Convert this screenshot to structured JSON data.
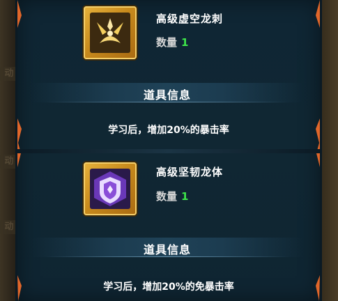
{
  "items": [
    {
      "name": "高级虚空龙刺",
      "quantity_label": "数量",
      "quantity": "1",
      "section_title": "道具信息",
      "description": "学习后，增加20%的暴击率",
      "icon": "void-dragon-claw-icon",
      "frame_color": "#d79a2a"
    },
    {
      "name": "高级坚韧龙体",
      "quantity_label": "数量",
      "quantity": "1",
      "section_title": "道具信息",
      "description": "学习后，增加20%的免暴击率",
      "icon": "shield-icon",
      "frame_color": "#d79a2a"
    }
  ],
  "background": {
    "ghost_label": "动"
  },
  "colors": {
    "panel": "#102733",
    "quantity_number": "#3ee64a",
    "accent_orange": "#e0662a"
  }
}
